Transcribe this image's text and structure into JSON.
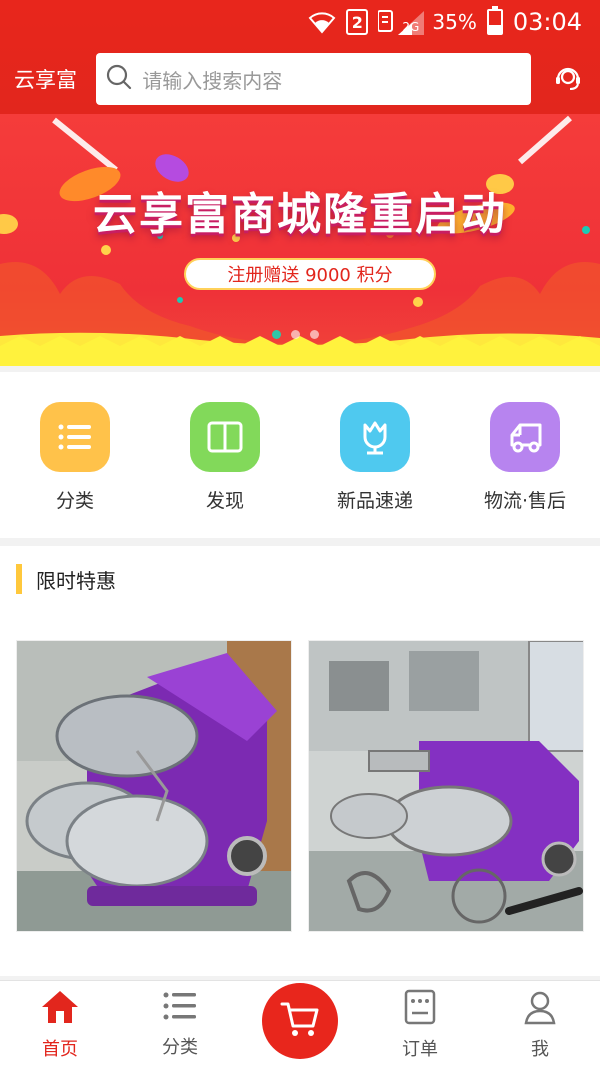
{
  "status_bar": {
    "sim_badge": "2",
    "network": "2G",
    "battery_percent": "35%",
    "battery_level": 0.35,
    "time": "03:04"
  },
  "header": {
    "brand": "云享富",
    "search_placeholder": "请输入搜索内容",
    "icons": {
      "search": "search-icon",
      "service": "customer-service-icon"
    }
  },
  "banner": {
    "title": "云享富商城隆重启动",
    "subtitle": "注册赠送 9000 积分",
    "slide_count": 3,
    "active_slide": 1
  },
  "categories": [
    {
      "label": "分类",
      "icon": "list-icon",
      "color": "#ffc24a"
    },
    {
      "label": "发现",
      "icon": "book-icon",
      "color": "#82d95a"
    },
    {
      "label": "新品速递",
      "icon": "flower-icon",
      "color": "#4fc9ef"
    },
    {
      "label": "物流·售后",
      "icon": "truck-icon",
      "color": "#b784ef"
    }
  ],
  "section": {
    "title": "限时特惠"
  },
  "bottom_nav": [
    {
      "label": "首页",
      "icon": "home-icon",
      "active": true
    },
    {
      "label": "分类",
      "icon": "list-icon",
      "active": false
    },
    {
      "label": "",
      "icon": "cart-icon",
      "active": false
    },
    {
      "label": "订单",
      "icon": "order-icon",
      "active": false
    },
    {
      "label": "我",
      "icon": "user-icon",
      "active": false
    }
  ],
  "colors": {
    "brand_red": "#e2261d",
    "accent_yellow": "#ffc83c"
  }
}
